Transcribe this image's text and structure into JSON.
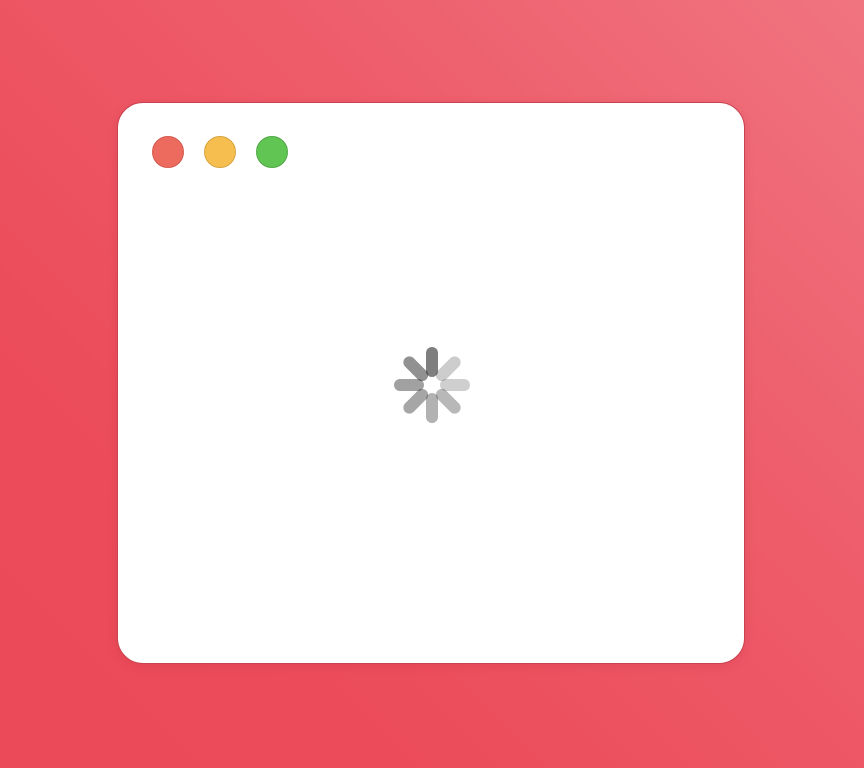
{
  "window": {
    "controls": [
      {
        "name": "close-button",
        "icon": "close-light-icon",
        "color": "#ed6a5e",
        "border": "#d4594d"
      },
      {
        "name": "minimize-button",
        "icon": "minimize-light-icon",
        "color": "#f5be4f",
        "border": "#d9a440"
      },
      {
        "name": "zoom-button",
        "icon": "zoom-light-icon",
        "color": "#61c553",
        "border": "#4ea844"
      }
    ]
  },
  "content": {
    "state": "loading",
    "icon": "loading-spinner-icon",
    "spoke_opacities": [
      0.5,
      0.2,
      0.19,
      0.28,
      0.3,
      0.35,
      0.37,
      0.43
    ]
  }
}
